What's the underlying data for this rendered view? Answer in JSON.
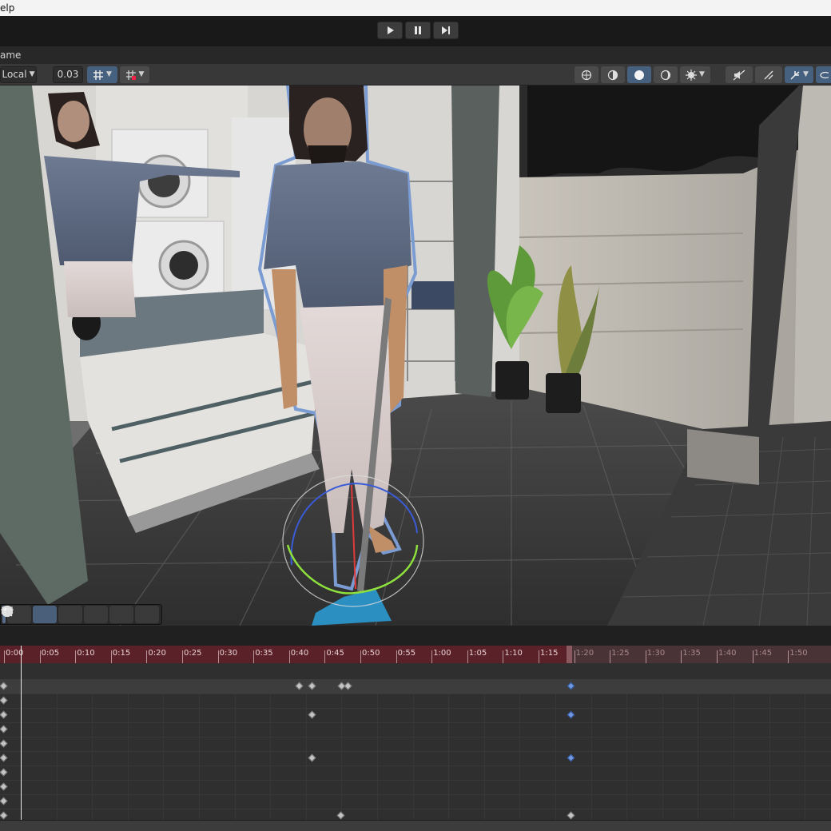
{
  "menubar": {
    "text": "elp"
  },
  "playbar": {
    "play_icon": "play-icon",
    "pause_icon": "pause-icon",
    "step_icon": "step-forward-icon"
  },
  "scene_tab": {
    "label": "ame"
  },
  "toolbar": {
    "pivot_label": "Local",
    "snap_value": "0.03",
    "icons": [
      "grid-snap-icon",
      "increment-snap-icon",
      "wireframe-shading-icon",
      "shaded-wireframe-icon",
      "shaded-icon",
      "lit-sphere-icon",
      "effects-icon",
      "audio-mute-icon",
      "2d-toggle-icon",
      "gizmos-icon",
      "visibility-icon"
    ]
  },
  "overlay_tools": [
    "view-tool-icon",
    "move-sphere-icon",
    "layers-icon",
    "search-icon",
    "move-arrows-icon",
    "camera-icon",
    "compass-icon"
  ],
  "timeline": {
    "ticks": [
      "0:00",
      "0:05",
      "0:10",
      "0:15",
      "0:20",
      "0:25",
      "0:30",
      "0:35",
      "0:40",
      "0:45",
      "0:50",
      "0:55",
      "1:00",
      "1:05",
      "1:10",
      "1:15",
      "1:20",
      "1:25",
      "1:30",
      "1:35",
      "1:40",
      "1:45",
      "1:50"
    ],
    "dim_from_index": 16,
    "playhead": "0:00"
  },
  "colors": {
    "ruler_active": "#5a2128",
    "ruler_inactive": "#4a3336",
    "selection_blue": "#6f98e0"
  }
}
